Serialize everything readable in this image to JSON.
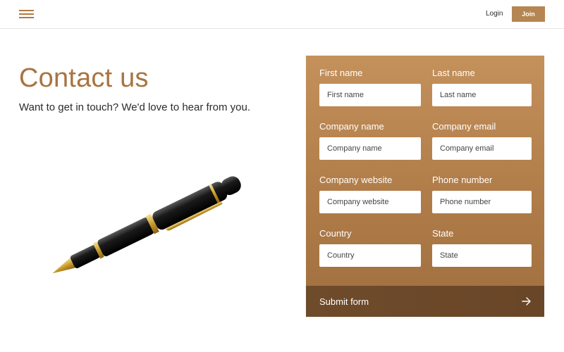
{
  "header": {
    "login_label": "Login",
    "join_label": "Join"
  },
  "hero": {
    "title": "Contact us",
    "subtitle": "Want to get in touch? We'd love to hear from you."
  },
  "form": {
    "fields": [
      {
        "label": "First name",
        "placeholder": "First name"
      },
      {
        "label": "Last name",
        "placeholder": "Last name"
      },
      {
        "label": "Company name",
        "placeholder": "Company name"
      },
      {
        "label": "Company email",
        "placeholder": "Company email"
      },
      {
        "label": "Company website",
        "placeholder": "Company website"
      },
      {
        "label": "Phone number",
        "placeholder": "Phone number"
      },
      {
        "label": "Country",
        "placeholder": "Country"
      },
      {
        "label": "State",
        "placeholder": "State"
      }
    ],
    "submit_label": "Submit form"
  },
  "colors": {
    "accent": "#b58651",
    "title": "#a87440",
    "panel_top": "#c4915c",
    "panel_bottom": "#a06f3e",
    "submit_bar": "#6e4b2b"
  },
  "icons": [
    "hamburger-menu-icon",
    "fountain-pen-illustration",
    "arrow-right-icon"
  ]
}
